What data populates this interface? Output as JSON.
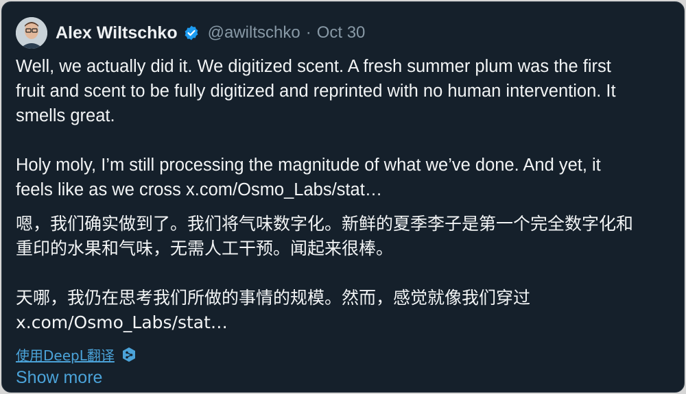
{
  "tweet": {
    "author_name": "Alex Wiltschko",
    "handle": "@awiltschko",
    "separator": "·",
    "date": "Oct 30",
    "text_lines": [
      "Well, we actually did it. We digitized scent. A fresh summer plum was the first",
      "fruit and scent to be fully digitized and reprinted with no human intervention. It",
      "smells great."
    ],
    "text_lines_2": [
      "Holy moly, I’m still processing the magnitude of what we’ve done. And yet, it"
    ],
    "text_line_2b_prefix": "feels like as we cross ",
    "link_text": "x.com/Osmo_Labs/stat…",
    "translation_lines": [
      "嗯，我们确实做到了。我们将气味数字化。新鲜的夏季李子是第一个完全数字化和",
      "重印的水果和气味，无需人工干预。闻起来很棒。"
    ],
    "translation_lines_2": [
      "天哪，我仍在思考我们所做的事情的规模。然而，感觉就像我们穿过",
      "x.com/Osmo_Labs/stat…"
    ],
    "translate_link": "使用DeepL翻译",
    "show_more": "Show more"
  },
  "icons": {
    "verified": "verified-badge-icon",
    "deepl": "deepl-icon"
  },
  "colors": {
    "background": "#15202b",
    "text": "#f2f4f5",
    "secondary_text": "#8899a6",
    "link": "#4ba3d9",
    "verified": "#1d9bf0"
  }
}
